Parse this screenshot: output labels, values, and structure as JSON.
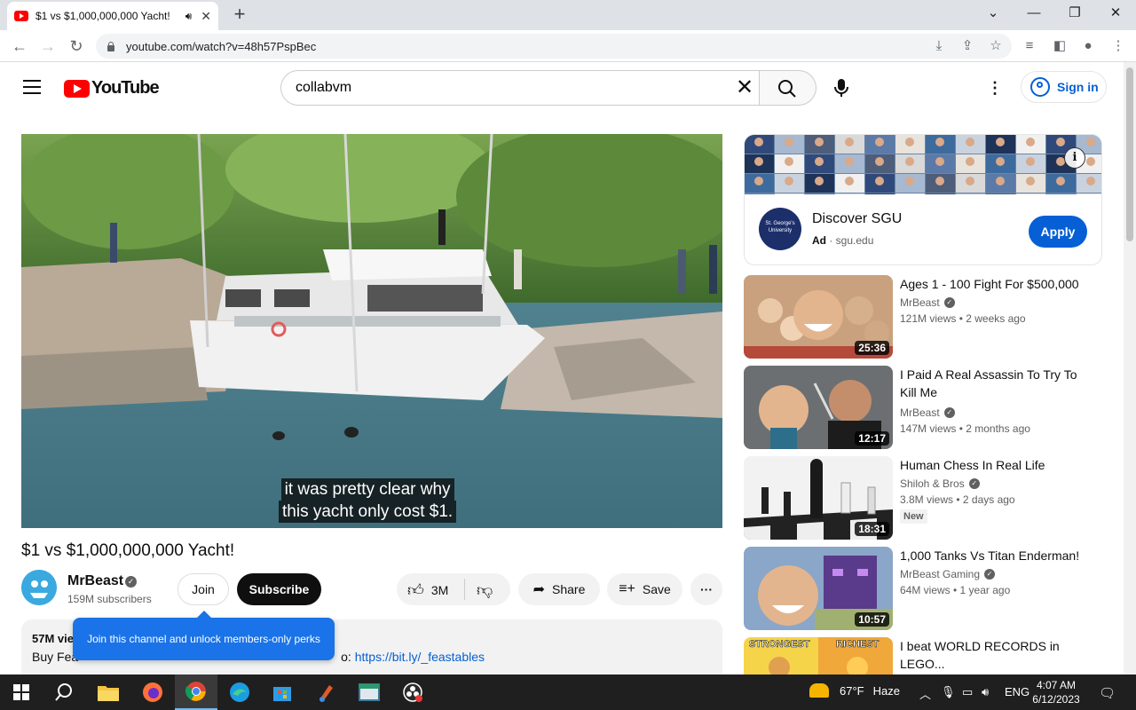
{
  "browser": {
    "tab_title": "$1 vs $1,000,000,000 Yacht!",
    "url": "youtube.com/watch?v=48h57PspBec"
  },
  "header": {
    "logo_text": "YouTube",
    "search_value": "collabvm",
    "sign_in_label": "Sign in"
  },
  "video": {
    "caption_line1": "it was pretty clear why",
    "caption_line2": "this yacht only cost $1.",
    "title": "$1 vs $1,000,000,000 Yacht!",
    "channel": "MrBeast",
    "subscribers": "159M subscribers",
    "join_label": "Join",
    "subscribe_label": "Subscribe",
    "likes": "3M",
    "share_label": "Share",
    "save_label": "Save",
    "views_partial": "57M vie",
    "desc_partial": "Buy Fea",
    "desc_link": "https://bit.ly/_feastables",
    "desc_mid": "o: ",
    "tooltip": "Join this channel and unlock members-only perks"
  },
  "ad": {
    "title": "Discover SGU",
    "ad_label": "Ad",
    "domain": "sgu.edu",
    "apply_label": "Apply",
    "logo_text": "St. George's University"
  },
  "recommendations": [
    {
      "title": "Ages 1 - 100 Fight For $500,000",
      "channel": "MrBeast",
      "verified": true,
      "meta": "121M views  • 2 weeks ago",
      "duration": "25:36",
      "badge": ""
    },
    {
      "title": "I Paid A Real Assassin To Try To Kill Me",
      "channel": "MrBeast",
      "verified": true,
      "meta": "147M views  • 2 months ago",
      "duration": "12:17",
      "badge": ""
    },
    {
      "title": "Human Chess In Real Life",
      "channel": "Shiloh & Bros",
      "verified": true,
      "meta": "3.8M views  • 2 days ago",
      "duration": "18:31",
      "badge": "New"
    },
    {
      "title": "1,000 Tanks Vs Titan Enderman!",
      "channel": "MrBeast Gaming",
      "verified": true,
      "meta": "64M views  • 1 year ago",
      "duration": "10:57",
      "badge": ""
    },
    {
      "title": "I beat WORLD RECORDS in LEGO...",
      "channel": "",
      "verified": false,
      "meta": "",
      "duration": "",
      "badge": "",
      "thumb_text_left": "STRONGEST",
      "thumb_text_right": "RICHEST"
    }
  ],
  "taskbar": {
    "temperature": "67°F",
    "weather": "Haze",
    "language": "ENG",
    "time": "4:07 AM",
    "date": "6/12/2023"
  }
}
